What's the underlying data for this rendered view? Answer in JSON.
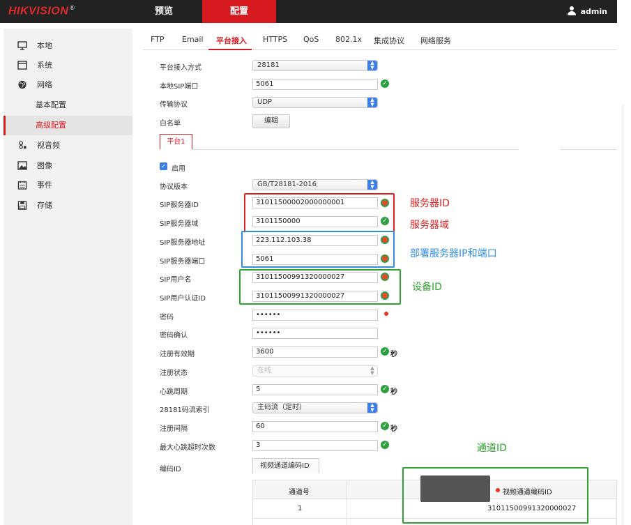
{
  "header": {
    "logo": "HIKVISION",
    "logo_mark": "®",
    "nav_preview": "预览",
    "nav_config": "配置",
    "user": "admin"
  },
  "sidebar": {
    "items": [
      {
        "label": "本地",
        "icon": "monitor-icon"
      },
      {
        "label": "系统",
        "icon": "window-icon"
      },
      {
        "label": "网络",
        "icon": "globe-icon"
      },
      {
        "label": "基本配置"
      },
      {
        "label": "高级配置"
      },
      {
        "label": "视音频",
        "icon": "camera-mic-icon"
      },
      {
        "label": "图像",
        "icon": "image-icon"
      },
      {
        "label": "事件",
        "icon": "calendar-icon"
      },
      {
        "label": "存储",
        "icon": "floppy-icon"
      }
    ]
  },
  "subtabs": [
    "FTP",
    "Email",
    "平台接入",
    "HTTPS",
    "QoS",
    "802.1x",
    "集成协议",
    "网络服务"
  ],
  "form": {
    "access_mode_label": "平台接入方式",
    "access_mode_value": "28181",
    "local_sip_port_label": "本地SIP端口",
    "local_sip_port_value": "5061",
    "transport_label": "传输协议",
    "transport_value": "UDP",
    "whitelist_label": "白名单",
    "edit_button": "编辑",
    "platform_tab": "平台1",
    "enable_label": "启用",
    "protocol_version_label": "协议版本",
    "protocol_version_value": "GB/T28181-2016",
    "sip_server_id_label": "SIP服务器ID",
    "sip_server_id_value": "31011500002000000001",
    "sip_server_domain_label": "SIP服务器域",
    "sip_server_domain_value": "3101150000",
    "sip_server_addr_label": "SIP服务器地址",
    "sip_server_addr_value": "223.112.103.38",
    "sip_server_port_label": "SIP服务器端口",
    "sip_server_port_value": "5061",
    "sip_username_label": "SIP用户名",
    "sip_username_value": "31011500991320000027",
    "sip_auth_id_label": "SIP用户认证ID",
    "sip_auth_id_value": "31011500991320000027",
    "password_label": "密码",
    "password_value": "••••••",
    "password_confirm_label": "密码确认",
    "password_confirm_value": "••••••",
    "reg_validity_label": "注册有效期",
    "reg_validity_value": "3600",
    "reg_status_label": "注册状态",
    "reg_status_value": "在线",
    "heartbeat_label": "心跳周期",
    "heartbeat_value": "5",
    "stream_index_label": "28181码流索引",
    "stream_index_value": "主码流（定时）",
    "reg_interval_label": "注册间隔",
    "reg_interval_value": "60",
    "max_heartbeat_timeout_label": "最大心跳超时次数",
    "max_heartbeat_timeout_value": "3",
    "encode_id_label": "编码ID",
    "seconds_unit": "秒"
  },
  "channel_table": {
    "tab_label": "视频通道编码ID",
    "columns": [
      "通道号",
      "视频通道编码ID"
    ],
    "rows": [
      {
        "channel": "1",
        "encode_id": "31011500991320000027"
      }
    ]
  },
  "annotations": {
    "server_id": "服务器ID",
    "server_domain": "服务器域",
    "deploy_server": "部署服务器IP和端口",
    "device_id": "设备ID",
    "channel_id": "通道ID"
  },
  "colors": {
    "brand_red": "#d71920",
    "annot_red": "#e02020",
    "annot_blue": "#2e8ee0",
    "annot_green": "#2ea52e",
    "ok_green": "#2ea043"
  }
}
